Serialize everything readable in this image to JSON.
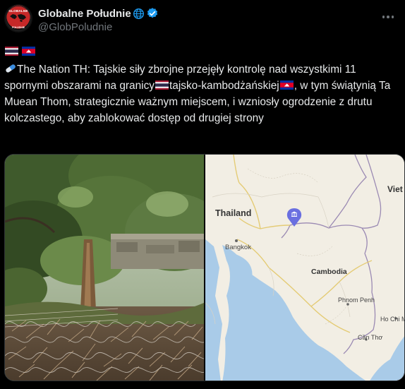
{
  "author": {
    "display_name": "Globalne Południe",
    "handle": "@GlobPoludnie",
    "avatar_line1": "GLOBALNE",
    "avatar_line2": "POŁUDNIE",
    "verified": true
  },
  "colors": {
    "background": "#000000",
    "text": "#e7e9ea",
    "muted": "#71767b",
    "verified_blue": "#1d9bf0"
  },
  "flags_header": [
    "flag-thailand",
    "flag-cambodia"
  ],
  "tweet": {
    "prefix_icon": "pill-icon",
    "part1": "The Nation TH: Tajskie siły zbrojne przejęły kontrolę nad wszystkimi 11 spornymi obszarami na granicy",
    "part2": "tajsko-kambodżańskiej",
    "part3": ", w tym świątynią Ta Muean Thom, strategicznie ważnym miejscem, i wzniosły ogrodzenie z drutu kolczastego, aby zablokować dostęp od drugiej strony"
  },
  "map": {
    "labels": {
      "thailand": "Thailand",
      "bangkok": "Bangkok",
      "cambodia": "Cambodia",
      "phnom_penh": "Phnom Penh",
      "ho_chi_minh": "Ho Chi M",
      "can_tho": "Cần Thơ",
      "viet": "Viet"
    },
    "pin_icon": "temple-pin-icon"
  }
}
